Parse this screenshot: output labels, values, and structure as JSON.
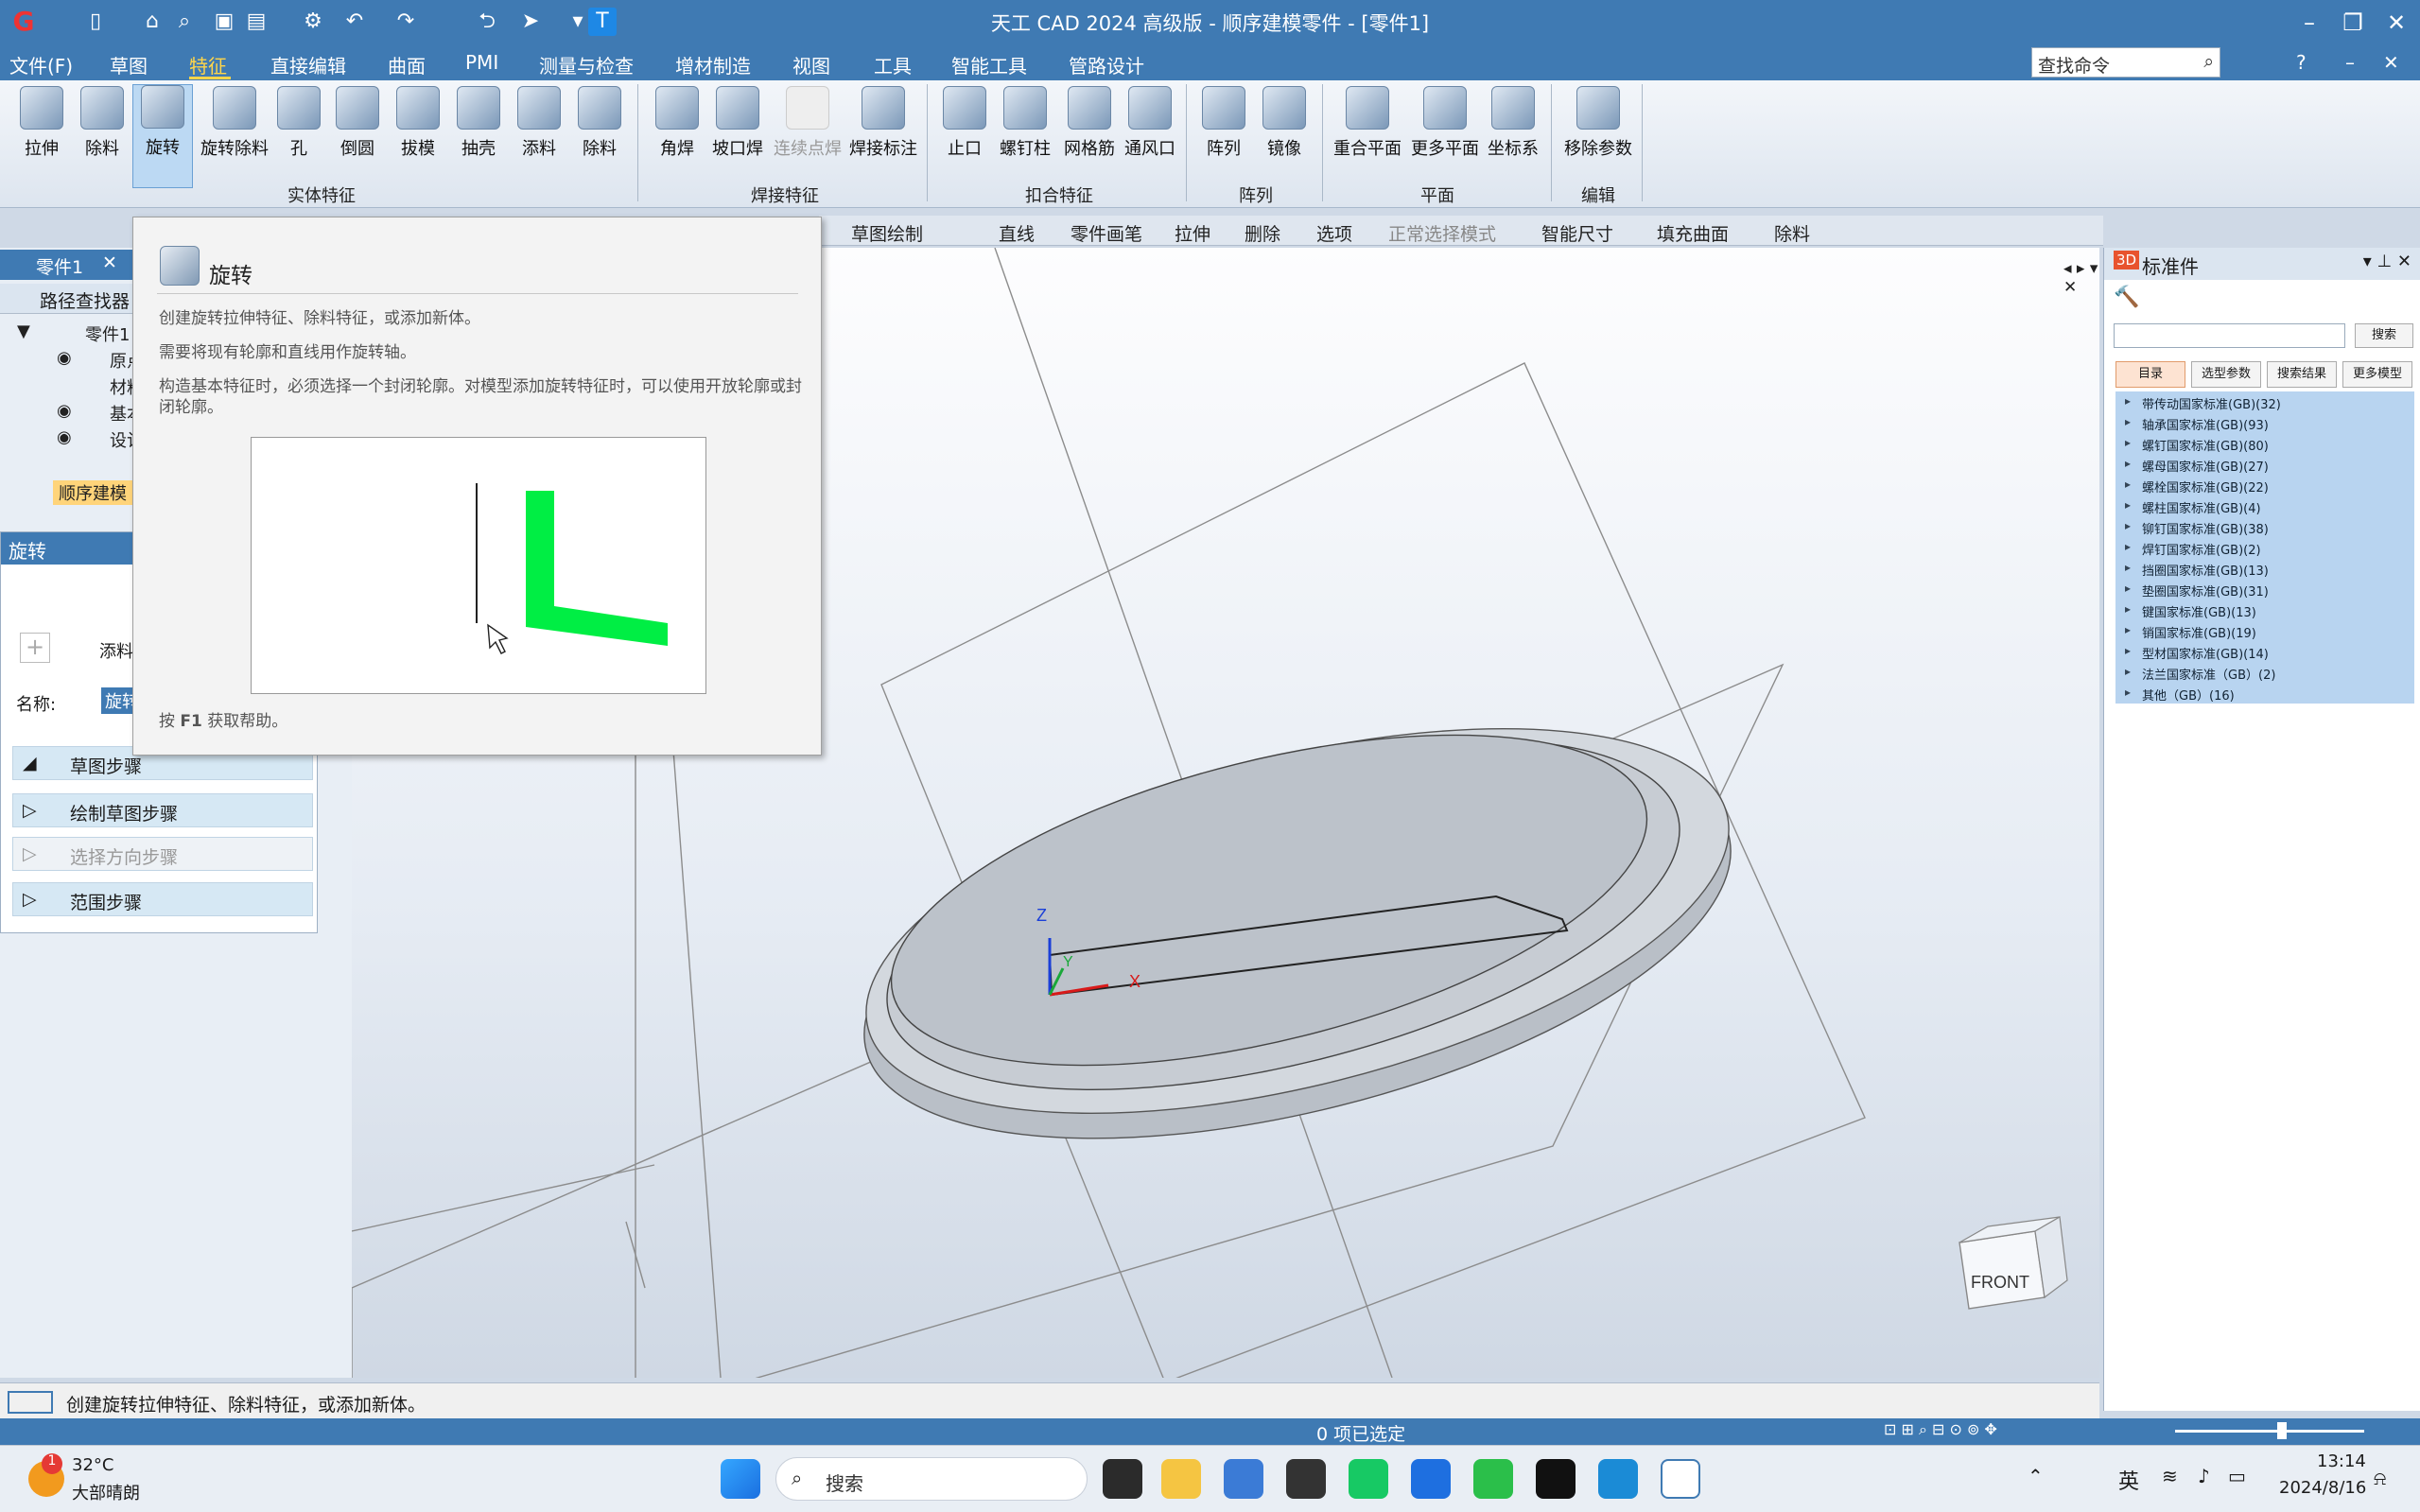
{
  "window": {
    "title": "天工 CAD 2024 高级版 - 顺序建模零件 - [零件1]"
  },
  "menu": {
    "file": "文件(F)",
    "items": [
      "草图",
      "特征",
      "直接编辑",
      "曲面",
      "PMI",
      "测量与检查",
      "增材制造",
      "视图",
      "工具",
      "智能工具",
      "管路设计"
    ],
    "search_placeholder": "查找命令"
  },
  "ribbon": {
    "solid_buttons": [
      "拉伸",
      "除料",
      "旋转",
      "旋转除料",
      "孔",
      "倒圆",
      "拔模",
      "抽壳",
      "添料",
      "除料"
    ],
    "solid_group": "实体特征",
    "weld_buttons": [
      "角焊",
      "坡口焊",
      "连续点焊",
      "焊接标注"
    ],
    "weld_group": "焊接特征",
    "snap_buttons": [
      "止口",
      "螺钉柱",
      "网格筋",
      "通风口"
    ],
    "snap_group": "扣合特征",
    "array_buttons": [
      "阵列",
      "镜像"
    ],
    "array_group": "阵列",
    "plane_buttons": [
      "重合平面",
      "更多平面",
      "坐标系"
    ],
    "plane_group": "平面",
    "edit_buttons": [
      "移除参数"
    ],
    "edit_group": "编辑"
  },
  "tooltip": {
    "title": "旋转",
    "line1": "创建旋转拉伸特征、除料特征，或添加新体。",
    "line2": "需要将现有轮廓和直线用作旋转轴。",
    "line3": "构造基本特征时，必须选择一个封闭轮廓。对模型添加旋转特征时，可以使用开放轮廓或封闭轮廓。",
    "help_key": "F1",
    "help_prefix": "按",
    "help_suffix": "获取帮助。"
  },
  "toolbar2": [
    "草图绘制",
    "直线",
    "零件画笔",
    "拉伸",
    "删除",
    "选项",
    "正常选择模式",
    "智能尺寸",
    "填充曲面",
    "除料"
  ],
  "left": {
    "tab": "零件1",
    "finder": "路径查找器",
    "tree": [
      "零件1",
      "原点",
      "材料",
      "基本",
      "设计",
      "顺序建模"
    ],
    "panel_title": "旋转",
    "add_label": "添料",
    "name_label": "名称:",
    "name_value": "旋转",
    "steps": [
      "草图步骤",
      "绘制草图步骤",
      "选择方向步骤",
      "范围步骤"
    ]
  },
  "viewport": {
    "axis_x": "X",
    "axis_y": "Y",
    "axis_z": "Z",
    "view_cube": "FRONT"
  },
  "right": {
    "title": "标准件",
    "search_button": "搜索",
    "tabs": [
      "目录",
      "选型参数",
      "搜索结果",
      "更多模型"
    ],
    "items": [
      "带传动国家标准(GB)(32)",
      "轴承国家标准(GB)(93)",
      "螺钉国家标准(GB)(80)",
      "螺母国家标准(GB)(27)",
      "螺栓国家标准(GB)(22)",
      "螺柱国家标准(GB)(4)",
      "铆钉国家标准(GB)(38)",
      "焊钉国家标准(GB)(2)",
      "挡圈国家标准(GB)(13)",
      "垫圈国家标准(GB)(31)",
      "键国家标准(GB)(13)",
      "销国家标准(GB)(19)",
      "型材国家标准(GB)(14)",
      "法兰国家标准（GB）(2)",
      "其他（GB）(16)"
    ]
  },
  "status": {
    "message": "创建旋转拉伸特征、除料特征，或添加新体。",
    "selected": "0 项已选定"
  },
  "taskbar": {
    "temp": "32°C",
    "weather": "大部晴朗",
    "badge": "1",
    "search": "搜索",
    "ime": "英",
    "time": "13:14",
    "date": "2024/8/16"
  },
  "colors": {
    "accent": "#3f7ab3",
    "menu_active": "#ffd54a",
    "profile_green": "#00ee44"
  }
}
